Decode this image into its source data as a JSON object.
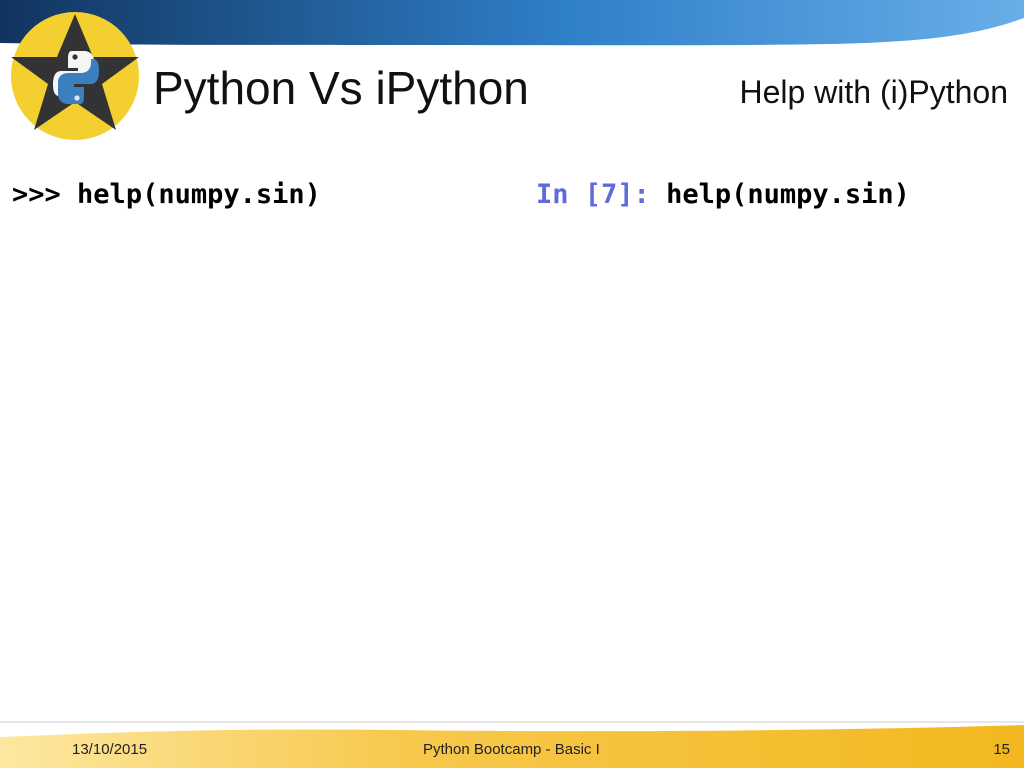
{
  "slide": {
    "title": "Python Vs iPython",
    "subtitle": "Help with (i)Python"
  },
  "code": {
    "python_prompt": ">>>",
    "python_command": "help(numpy.sin)",
    "ipython_prompt": "In [7]:",
    "ipython_command": "help(numpy.sin)"
  },
  "footer": {
    "date": "13/10/2015",
    "center": "Python Bootcamp - Basic I",
    "page": "15"
  },
  "colors": {
    "header_blue": "#2f7fc8",
    "footer_gold": "#f3b81f",
    "logo_yellow": "#f3cf2f",
    "logo_star": "#333333",
    "ipython_prompt": "#5f6bd8"
  },
  "icons": {
    "logo": "python-star-logo-icon"
  }
}
